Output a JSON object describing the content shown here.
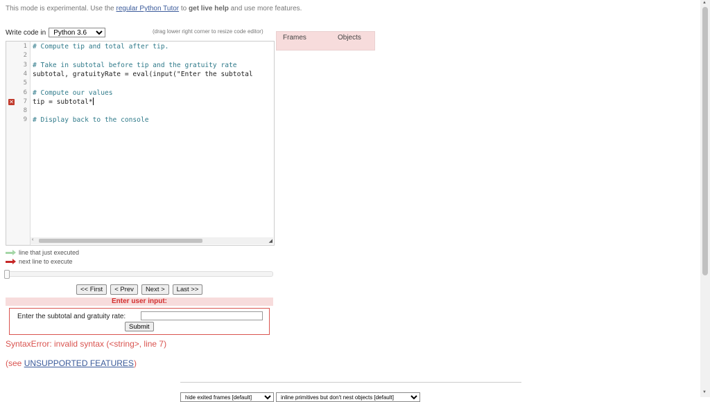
{
  "banner": {
    "prefix": "This mode is experimental. Use the ",
    "link": "regular Python Tutor",
    "middle": " to ",
    "bold": "get live help",
    "suffix": " and use more features."
  },
  "editor_controls": {
    "write_code_label": "Write code in",
    "language": "Python 3.6",
    "drag_hint": "(drag lower right corner to resize code editor)"
  },
  "code": {
    "lines": [
      {
        "num": "1",
        "text": "# Compute tip and total after tip.",
        "comment": true
      },
      {
        "num": "2",
        "text": "",
        "comment": false
      },
      {
        "num": "3",
        "text": "# Take in subtotal before tip and the gratuity rate",
        "comment": true
      },
      {
        "num": "4",
        "text": "subtotal, gratuityRate = eval(input(\"Enter the subtotal",
        "comment": false
      },
      {
        "num": "5",
        "text": "",
        "comment": false
      },
      {
        "num": "6",
        "text": "# Compute our values",
        "comment": true
      },
      {
        "num": "7",
        "text": "tip = subtotal*",
        "comment": false
      },
      {
        "num": "8",
        "text": "",
        "comment": false
      },
      {
        "num": "9",
        "text": "# Display back to the console",
        "comment": true
      }
    ],
    "error_line": "7",
    "error_icon": "x-icon"
  },
  "visualizer": {
    "frames_label": "Frames",
    "objects_label": "Objects"
  },
  "legend": {
    "just_executed": "line that just executed",
    "next_line": "next line to execute",
    "green_color": "#a5d6a7",
    "red_color": "#c62828"
  },
  "navigation": {
    "first": "<< First",
    "prev": "< Prev",
    "next": "Next >",
    "last": "Last >>"
  },
  "user_input": {
    "header": "Enter user input:",
    "prompt": "Enter the subtotal and gratuity rate:",
    "value": "",
    "submit": "Submit"
  },
  "error": {
    "message": "SyntaxError: invalid syntax (<string>, line 7)",
    "see_prefix": "(see ",
    "see_link": "UNSUPPORTED FEATURES",
    "see_suffix": ")"
  },
  "bottom": {
    "frames_option": "hide exited frames [default]",
    "primitives_option": "inline primitives but don't nest objects [default]"
  },
  "colors": {
    "error_red": "#d9534f",
    "header_pink": "#f7dcdc",
    "link_blue": "#3a5a9a"
  }
}
